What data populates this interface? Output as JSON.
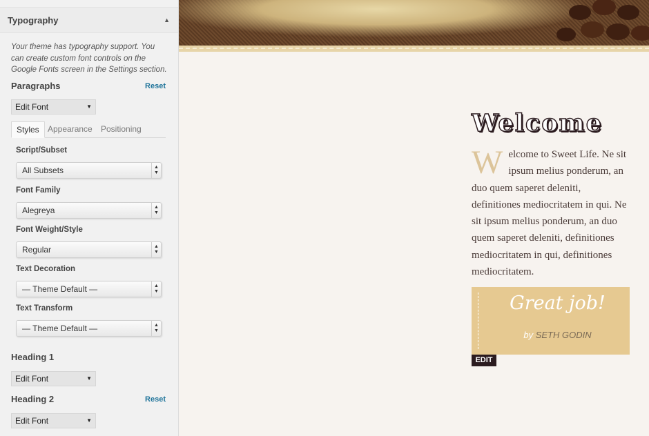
{
  "sidebar": {
    "section_title": "Typography",
    "description": "Your theme has typography support. You can create custom font controls on the Google Fonts screen in the Settings section.",
    "paragraphs": {
      "title": "Paragraphs",
      "reset_label": "Reset",
      "edit_font_label": "Edit Font",
      "tabs": [
        "Styles",
        "Appearance",
        "Positioning"
      ],
      "fields": [
        {
          "label": "Script/Subset",
          "value": "All Subsets"
        },
        {
          "label": "Font Family",
          "value": "Alegreya"
        },
        {
          "label": "Font Weight/Style",
          "value": "Regular"
        },
        {
          "label": "Text Decoration",
          "value": "— Theme Default —"
        },
        {
          "label": "Text Transform",
          "value": "— Theme Default —"
        }
      ]
    },
    "heading1": {
      "title": "Heading 1",
      "edit_font_label": "Edit Font"
    },
    "heading2": {
      "title": "Heading 2",
      "reset_label": "Reset",
      "edit_font_label": "Edit Font"
    }
  },
  "preview": {
    "welcome_title": "Welcome",
    "dropcap": "W",
    "body": "elcome to Sweet Life. Ne sit ipsum melius ponderum, an duo quem saperet deleniti, definitiones mediocritatem in qui. Ne sit ipsum melius ponderum, an duo quem saperet deleniti, definitiones mediocritatem in qui, definitiones mediocritatem.",
    "quote": {
      "text": "Great job!",
      "by": "by",
      "author": "SETH GODIN"
    },
    "edit_label": "EDIT"
  }
}
